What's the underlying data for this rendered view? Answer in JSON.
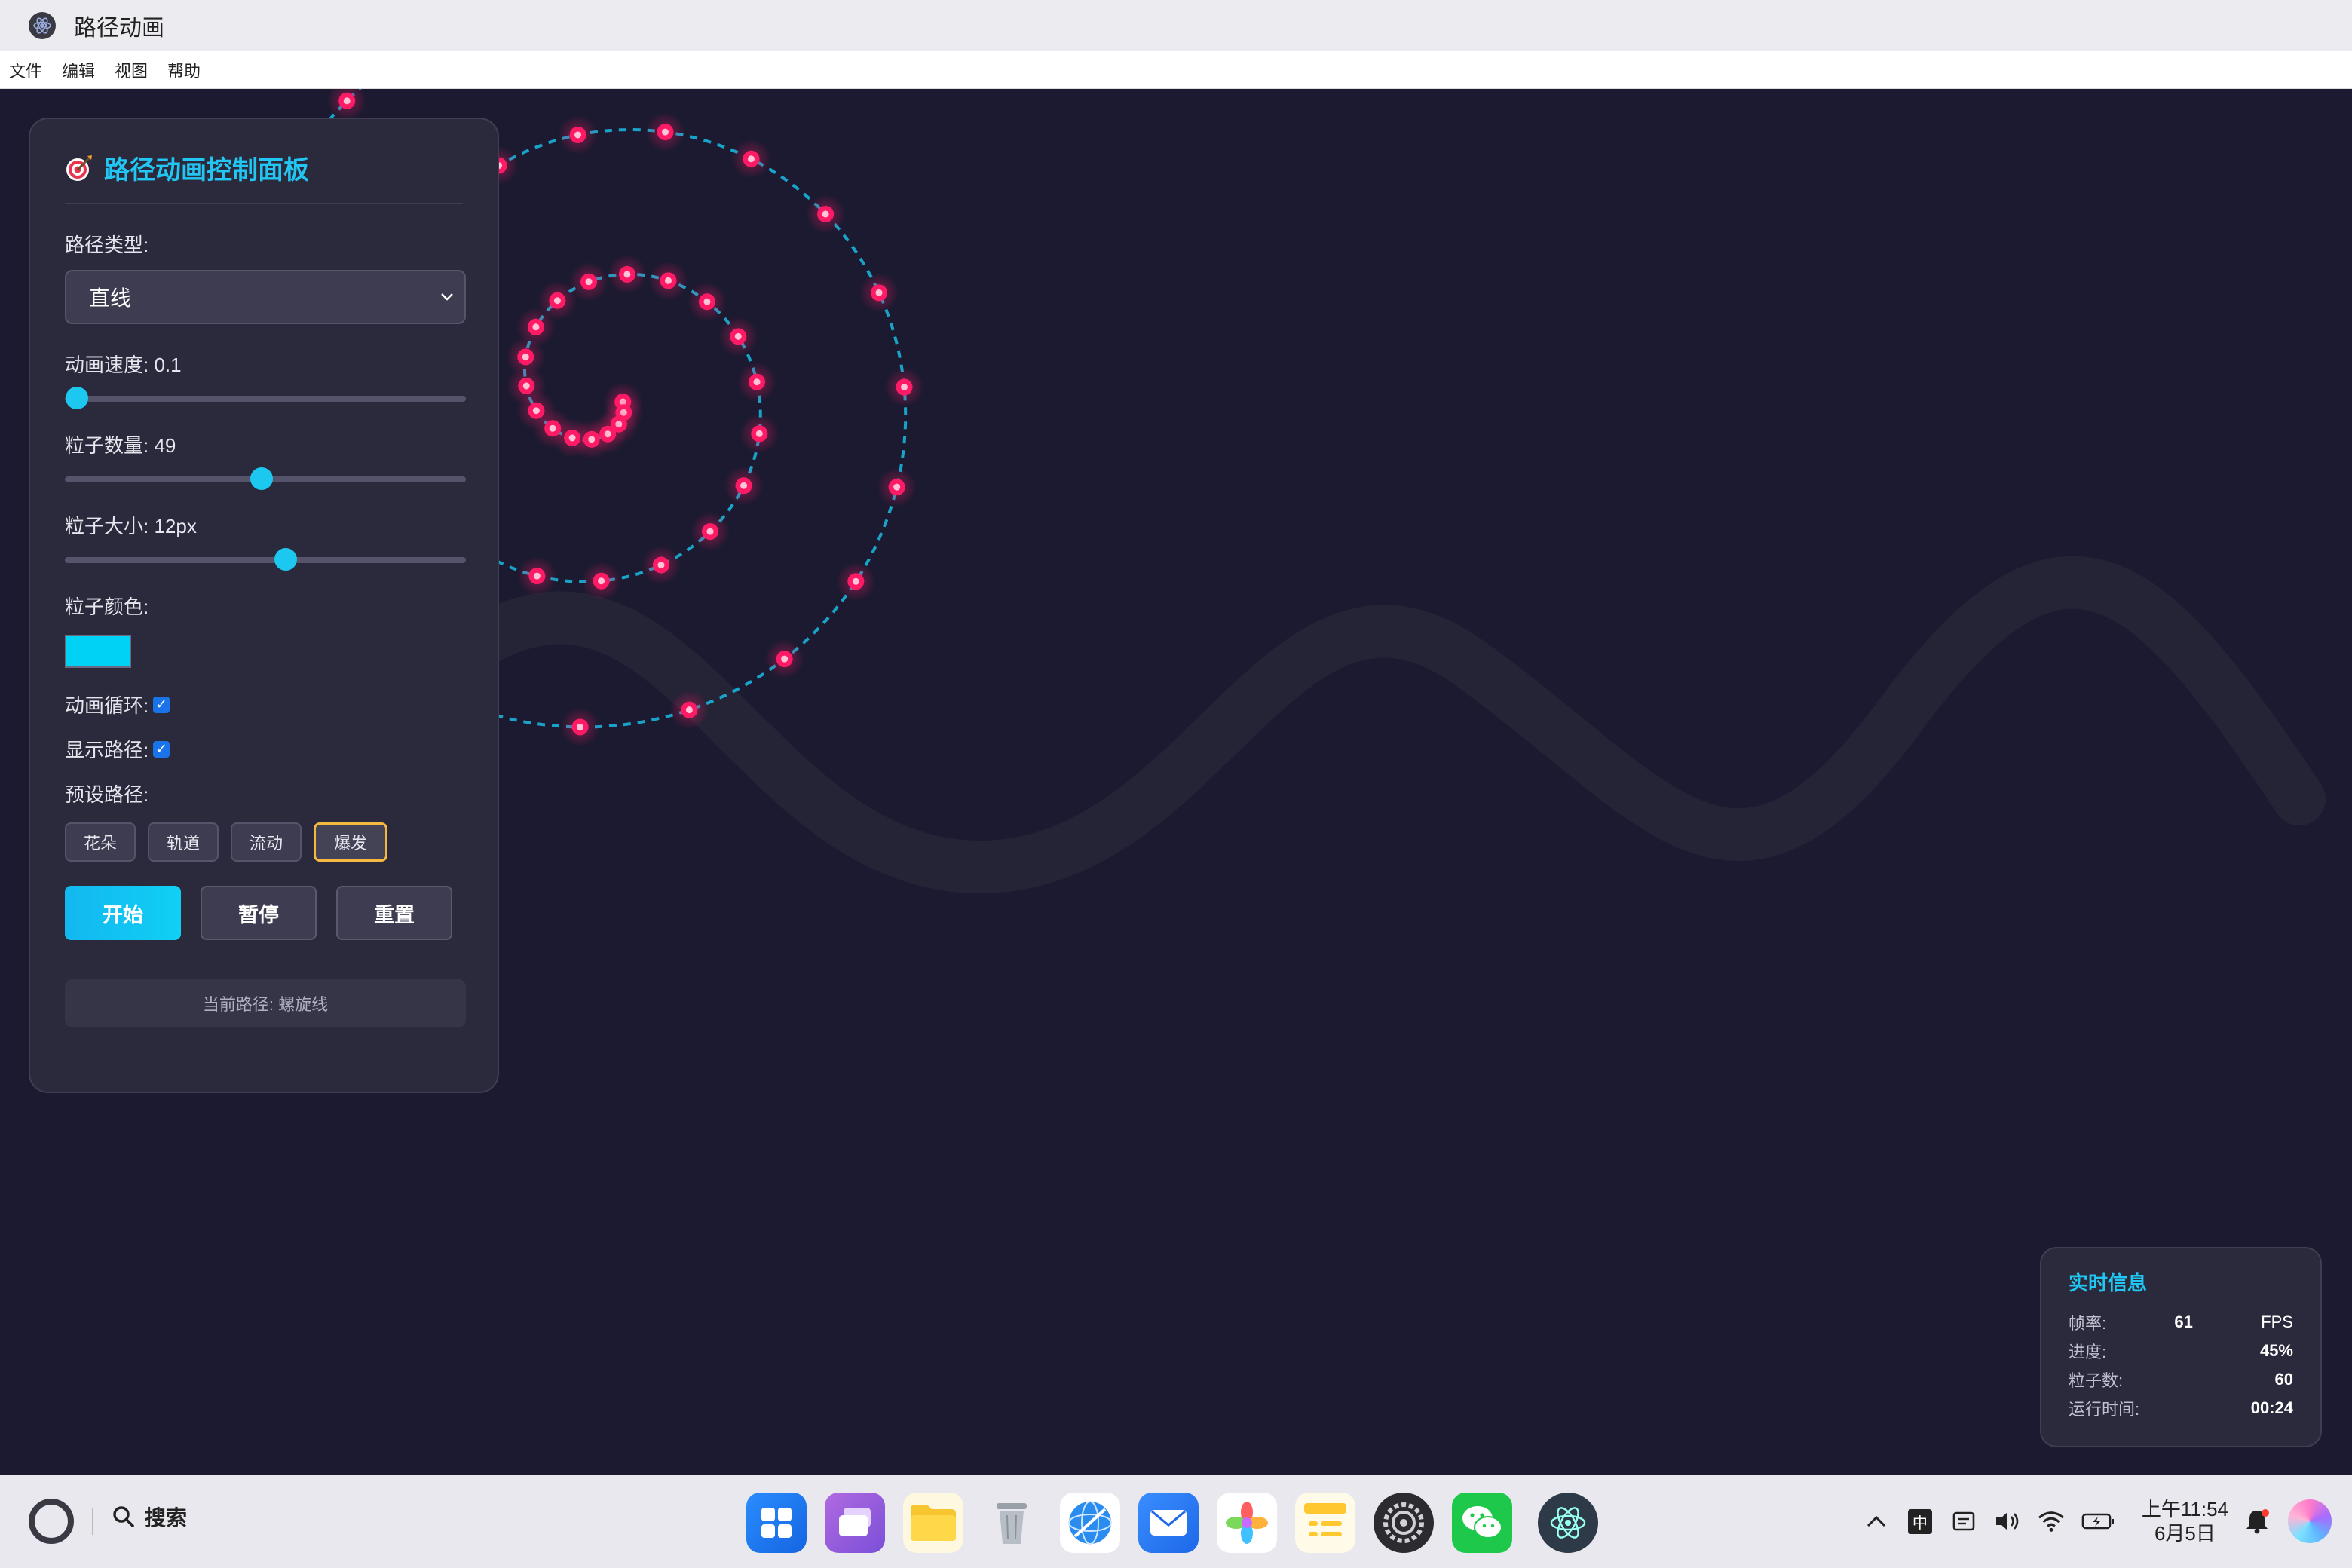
{
  "window": {
    "title": "路径动画"
  },
  "menu": [
    "文件",
    "编辑",
    "视图",
    "帮助"
  ],
  "panel": {
    "title": "路径动画控制面板",
    "path_type_label": "路径类型:",
    "path_type_value": "直线",
    "speed_label": "动画速度: 0.1",
    "speed_fraction": 0.03,
    "count_label": "粒子数量: 49",
    "count_fraction": 0.49,
    "size_label": "粒子大小: 12px",
    "size_fraction": 0.55,
    "color_label": "粒子颜色:",
    "color_value": "#00d2f5",
    "loop_label": "动画循环:",
    "loop_checked": true,
    "show_path_label": "显示路径:",
    "show_path_checked": true,
    "presets_label": "预设路径:",
    "presets": [
      "花朵",
      "轨道",
      "流动",
      "爆发"
    ],
    "active_preset": "爆发",
    "start_label": "开始",
    "pause_label": "暂停",
    "reset_label": "重置",
    "current_path": "当前路径: 螺旋线"
  },
  "info": {
    "title": "实时信息",
    "fps_label": "帧率:",
    "fps_value": "61",
    "fps_unit": "FPS",
    "progress_label": "进度:",
    "progress_value": "45%",
    "particles_label": "粒子数:",
    "particles_value": "60",
    "runtime_label": "运行时间:",
    "runtime_value": "00:24"
  },
  "taskbar": {
    "search_label": "搜索",
    "ime_label": "中",
    "time": "上午11:54",
    "date": "6月5日",
    "dock_icons": [
      "launcher-icon",
      "multitask-icon",
      "files-icon",
      "trash-icon",
      "browser-icon",
      "mail-icon",
      "photos-icon",
      "notes-icon",
      "settings-icon",
      "wechat-icon",
      "electron-app-icon"
    ]
  },
  "colors": {
    "accent": "#22c6f2",
    "particle": "#ff1a66",
    "path": "#1aa3c8",
    "background": "#1c1a30"
  }
}
